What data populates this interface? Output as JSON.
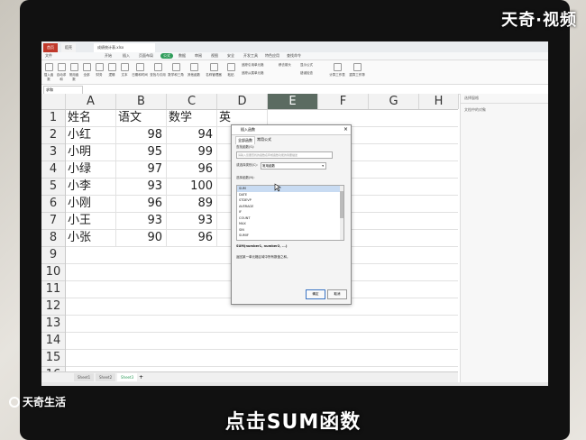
{
  "brand_logo": "天奇·视频",
  "app": {
    "tabs": [
      "首页",
      "稻壳",
      "成绩统计表.xlsx"
    ],
    "menu": [
      "文件",
      "开始",
      "插入",
      "页面布局",
      "公式",
      "数据",
      "审阅",
      "视图",
      "安全",
      "开发工具",
      "特色应用",
      "查找命令"
    ],
    "active_menu": "公式",
    "ribbon_buttons": [
      "插入函数",
      "自动求和",
      "常用函数",
      "全部",
      "财务",
      "逻辑",
      "文本",
      "日期和时间",
      "查找与引用",
      "数学和三角",
      "其他函数",
      "名称管理器",
      "粘贴",
      "追踪引用单元格",
      "追踪从属单元格",
      "移去箭头",
      "显示公式",
      "错误检查",
      "计算工作表",
      "重算工作簿"
    ],
    "name_box": "求和",
    "right_pane_title": "选择窗格",
    "right_pane_sub": "文档中的对象"
  },
  "sheet": {
    "columns": [
      "A",
      "B",
      "C",
      "D",
      "E",
      "F",
      "G",
      "H"
    ],
    "selected_column": "E",
    "rows": [
      "1",
      "2",
      "3",
      "4",
      "5",
      "6",
      "7",
      "8",
      "9",
      "10",
      "11",
      "12",
      "13",
      "14",
      "15",
      "16"
    ],
    "header_row": [
      "姓名",
      "语文",
      "数学",
      "英"
    ],
    "data": [
      {
        "name": "小红",
        "chinese": "98",
        "math": "94"
      },
      {
        "name": "小明",
        "chinese": "95",
        "math": "99"
      },
      {
        "name": "小绿",
        "chinese": "97",
        "math": "96"
      },
      {
        "name": "小李",
        "chinese": "93",
        "math": "100"
      },
      {
        "name": "小刚",
        "chinese": "96",
        "math": "89"
      },
      {
        "name": "小王",
        "chinese": "93",
        "math": "93"
      },
      {
        "name": "小张",
        "chinese": "90",
        "math": "96"
      }
    ],
    "sheet_tabs": [
      "Sheet1",
      "Sheet2",
      "Sheet3"
    ],
    "active_sheet": "Sheet3"
  },
  "dialog": {
    "title": "插入函数",
    "tabs": [
      "全部函数",
      "常用公式"
    ],
    "search_label": "查找函数(S):",
    "search_placeholder": "请输入您要查找的函数名称或函数功能的简要描述",
    "category_label": "或选择类别(C):",
    "category_value": "常用函数",
    "list_label": "选择函数(N):",
    "functions": [
      "SUM",
      "DATE",
      "STDEVP",
      "AVERAGE",
      "IF",
      "COUNT",
      "MAX",
      "SIN",
      "SUMIF"
    ],
    "selected_function": "SUM",
    "signature": "SUM(number1, number2, ...)",
    "description": "返回某一单元格区域中所有数值之和。",
    "ok": "确定",
    "cancel": "取消"
  },
  "footer_logo": "天奇生活",
  "subtitle": "点击SUM函数"
}
